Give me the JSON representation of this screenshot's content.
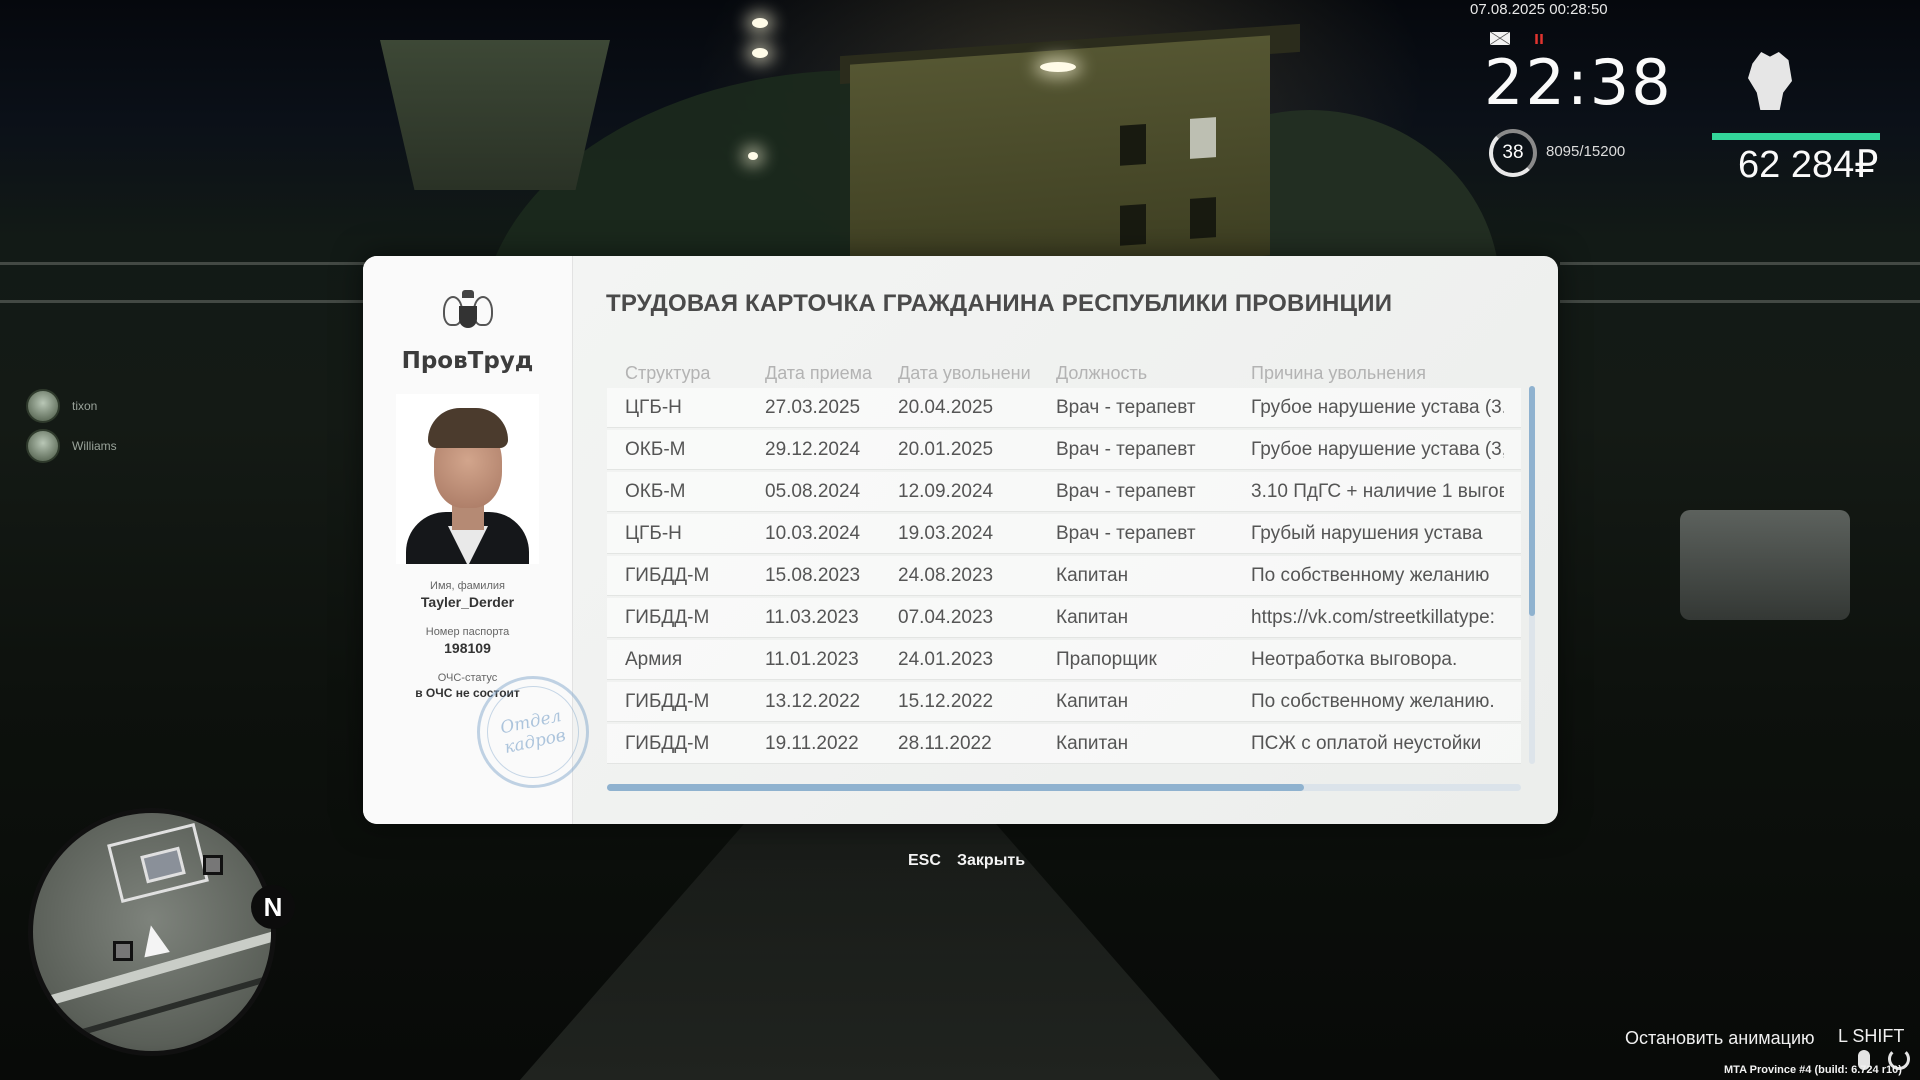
{
  "hud": {
    "datetime": "07.08.2025 00:28:50",
    "time": "22:38",
    "level": "38",
    "xp": "8095/15200",
    "health_fraction": 1.0,
    "money": "62 284₽",
    "icons": [
      "mail-icon",
      "food-icon",
      "fist-icon"
    ]
  },
  "players": [
    {
      "name": "tixon"
    },
    {
      "name": "Williams"
    }
  ],
  "minimap": {
    "north_label": "N"
  },
  "dialog": {
    "org_name": "ПровТруд",
    "title": "ТРУДОВАЯ КАРТОЧКА ГРАЖДАНИНА РЕСПУБЛИКИ ПРОВИНЦИИ",
    "name_label": "Имя, фамилия",
    "name_value": "Tayler_Derder",
    "passport_label": "Номер паспорта",
    "passport_value": "198109",
    "ochs_label": "ОЧС-статус",
    "ochs_value": "в ОЧС не состоит",
    "stamp_text": "Отдел кадров",
    "columns": [
      "Структура",
      "Дата приема",
      "Дата увольнени",
      "Должность",
      "Причина увольнения"
    ],
    "rows": [
      {
        "structure": "ЦГБ-Н",
        "hired": "27.03.2025",
        "fired": "20.04.2025",
        "position": "Врач - терапевт",
        "reason": "Грубое нарушение устава (3."
      },
      {
        "structure": "ОКБ-М",
        "hired": "29.12.2024",
        "fired": "20.01.2025",
        "position": "Врач - терапевт",
        "reason": "Грубое нарушение устава (3,"
      },
      {
        "structure": "ОКБ-М",
        "hired": "05.08.2024",
        "fired": "12.09.2024",
        "position": "Врач - терапевт",
        "reason": "3.10 ПдГС + наличие 1 выгов"
      },
      {
        "structure": "ЦГБ-Н",
        "hired": "10.03.2024",
        "fired": "19.03.2024",
        "position": "Врач - терапевт",
        "reason": "Грубый нарушения устава"
      },
      {
        "structure": "ГИБДД-М",
        "hired": "15.08.2023",
        "fired": "24.08.2023",
        "position": "Капитан",
        "reason": "По собственному желанию"
      },
      {
        "structure": "ГИБДД-М",
        "hired": "11.03.2023",
        "fired": "07.04.2023",
        "position": "Капитан",
        "reason": "https://vk.com/streetkillatype:"
      },
      {
        "structure": "Армия",
        "hired": "11.01.2023",
        "fired": "24.01.2023",
        "position": "Прапорщик",
        "reason": "Неотработка выговора."
      },
      {
        "structure": "ГИБДД-М",
        "hired": "13.12.2022",
        "fired": "15.12.2022",
        "position": "Капитан",
        "reason": "По собственному желанию."
      },
      {
        "structure": "ГИБДД-М",
        "hired": "19.11.2022",
        "fired": "28.11.2022",
        "position": "Капитан",
        "reason": "ПСЖ с оплатой неустойки"
      }
    ],
    "esc_label": "ESC",
    "close_label": "Закрыть"
  },
  "hints": {
    "stop_animation": "Остановить анимацию",
    "key": "L SHIFT",
    "build": "MTA Province #4 (build: 6.724 r10)"
  },
  "colors": {
    "accent": "#8fb2cf",
    "health": "#33d69a",
    "food_icon": "#e0342f"
  }
}
